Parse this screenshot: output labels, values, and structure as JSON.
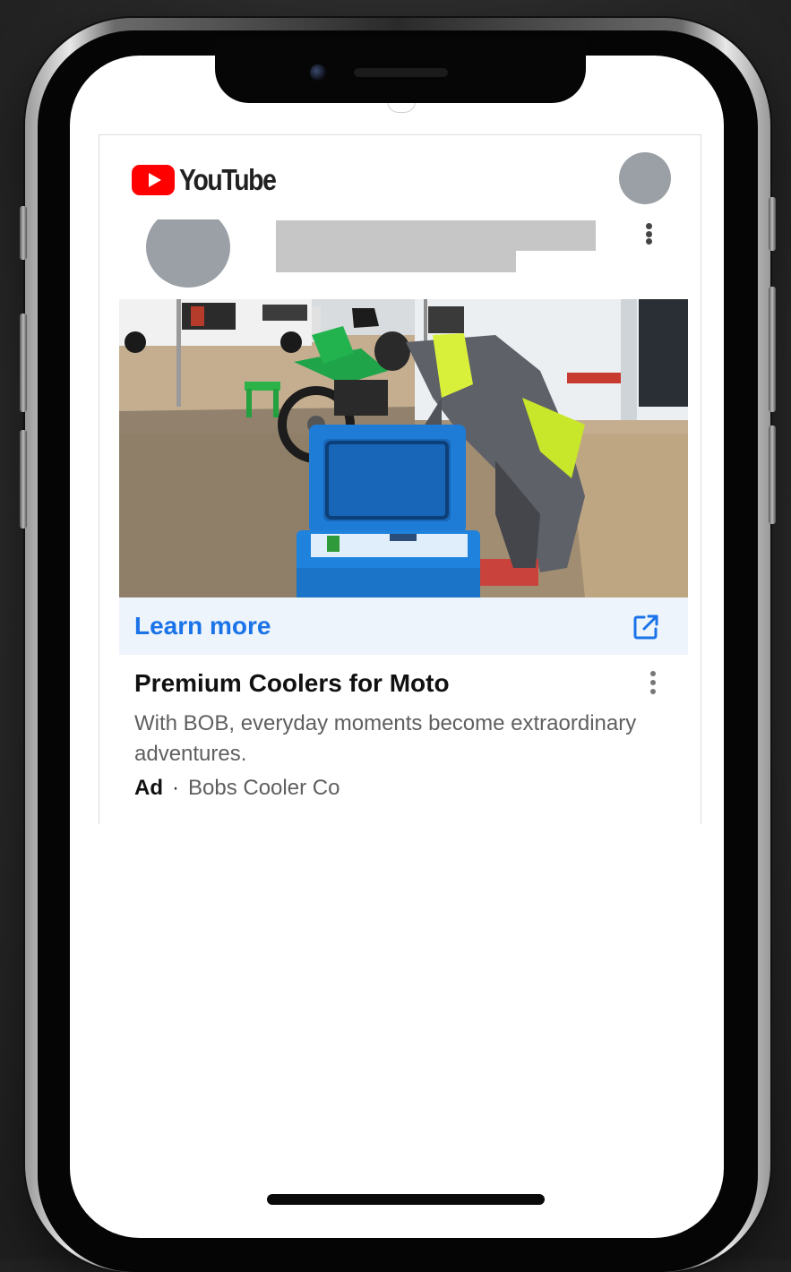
{
  "header": {
    "brand": "YouTube"
  },
  "ad": {
    "cta_label": "Learn more",
    "title": "Premium Coolers for Moto",
    "description": "With BOB, everyday moments become extraordinary adventures.",
    "badge": "Ad",
    "separator": "·",
    "advertiser": "Bobs Cooler Co"
  },
  "colors": {
    "brand_red": "#ff0000",
    "link_blue": "#1a73e8",
    "cta_background": "#eef4fb",
    "placeholder_gray": "#c6c6c6",
    "avatar_gray": "#9aa0a6"
  },
  "icons": {
    "brand": "youtube-play-icon",
    "overflow": "more-vert-icon",
    "external": "open-in-new-icon"
  }
}
